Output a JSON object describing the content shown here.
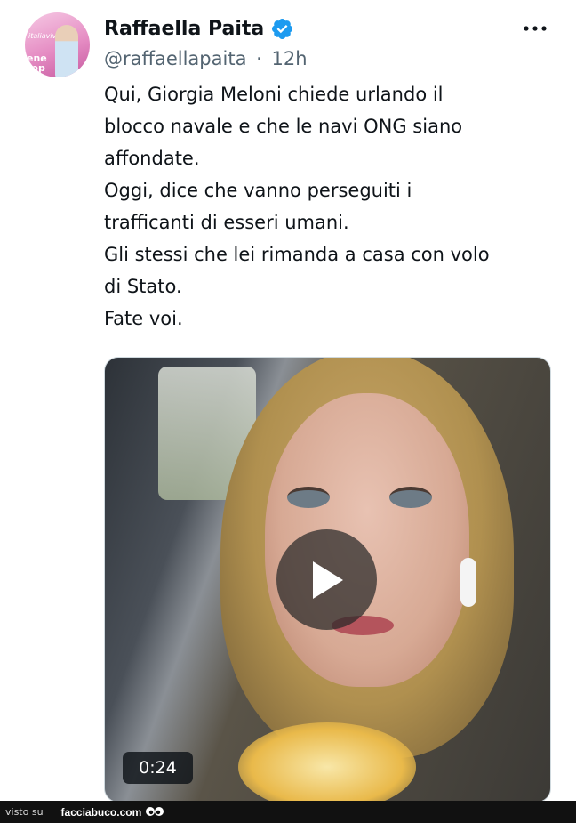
{
  "author": {
    "name": "Raffaella Paita",
    "handle": "@raffaellapaita",
    "separator": "·",
    "time": "12h",
    "avatar_text": "ene\nrop",
    "avatar_logo": "italiaviva"
  },
  "tweet": {
    "lines": [
      "Qui, Giorgia Meloni chiede urlando il",
      "blocco navale e che le navi ONG siano",
      "affondate.",
      "Oggi, dice che vanno perseguiti i",
      "trafficanti di esseri umani.",
      "Gli stessi che lei rimanda a casa con volo",
      "di Stato.",
      "Fate voi."
    ]
  },
  "media": {
    "duration": "0:24"
  },
  "footer": {
    "seen_on": "visto su",
    "site": "facciabuco.com"
  },
  "colors": {
    "verified": "#1d9bf0",
    "handle": "#536471",
    "text": "#0f1419"
  },
  "icons": [
    "verified-badge-icon",
    "more-options-icon",
    "play-icon",
    "mascot-eyes-icon"
  ]
}
